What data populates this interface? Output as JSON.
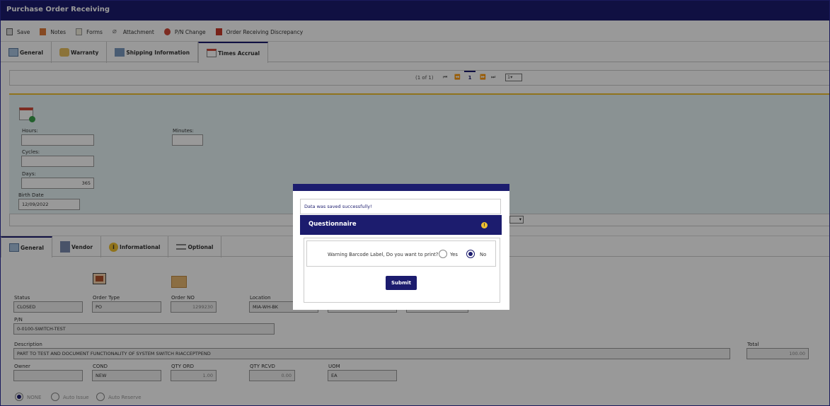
{
  "window": {
    "title": "Purchase Order Receiving"
  },
  "toolbar": [
    {
      "label": "Save",
      "icon": "save-icon"
    },
    {
      "label": "Notes",
      "icon": "notes-icon"
    },
    {
      "label": "Forms",
      "icon": "forms-icon"
    },
    {
      "label": "Attachment",
      "icon": "attachment-icon"
    },
    {
      "label": "P/N Change",
      "icon": "pn-change-icon"
    },
    {
      "label": "Order Receiving Discrepancy",
      "icon": "discrepancy-icon"
    }
  ],
  "top_tabs": [
    {
      "label": "General"
    },
    {
      "label": "Warranty"
    },
    {
      "label": "Shipping Information"
    },
    {
      "label": "Times Accrual"
    }
  ],
  "pager": {
    "count": "(1 of 1)",
    "page": "1",
    "size": "1"
  },
  "times": {
    "hours_label": "Hours:",
    "hours_value": "",
    "minutes_label": "Minutes:",
    "minutes_value": "",
    "cycles_label": "Cycles:",
    "cycles_value": "",
    "days_label": "Days:",
    "days_value": "365",
    "birth_label": "Birth Date",
    "birth_value": "12/09/2022"
  },
  "bottom_tabs": [
    {
      "label": "General"
    },
    {
      "label": "Vendor"
    },
    {
      "label": "Informational"
    },
    {
      "label": "Optional"
    }
  ],
  "form": {
    "status_label": "Status",
    "status_value": "CLOSED",
    "order_type_label": "Order Type",
    "order_type_value": "PO",
    "order_no_label": "Order NO",
    "order_no_value": "1299230",
    "location_label": "Location",
    "location_value": "MIA-WH-BK",
    "pn_label": "P/N",
    "pn_value": "0-0100-SWITCH-TEST",
    "desc_label": "Description",
    "desc_value": "PART TO TEST AND DOCUMENT FUNCTIONALITY OF SYSTEM SWITCH RIACCEPTPEND",
    "total_label": "Total",
    "total_value": "100.00",
    "owner_label": "Owner",
    "owner_value": "",
    "cond_label": "COND",
    "cond_value": "NEW",
    "qty_ord_label": "QTY ORD",
    "qty_ord_value": "1.00",
    "qty_rcvd_label": "QTY RCVD",
    "qty_rcvd_value": "0.00",
    "uom_label": "UOM",
    "uom_value": "EA",
    "radio_none": "NONE",
    "radio_auto_issue": "Auto Issue",
    "radio_auto_reserve": "Auto Reserve"
  },
  "modal": {
    "message": "Data was saved successfully!",
    "header": "Questionnaire",
    "question": "Warning Barcode Label, Do you want to print?",
    "yes_label": "Yes",
    "no_label": "No",
    "selected": "No",
    "submit_label": "Submit"
  },
  "colors": {
    "brand": "#1c1c6e",
    "panel": "#e6f3f5",
    "accent": "#f0c030"
  }
}
